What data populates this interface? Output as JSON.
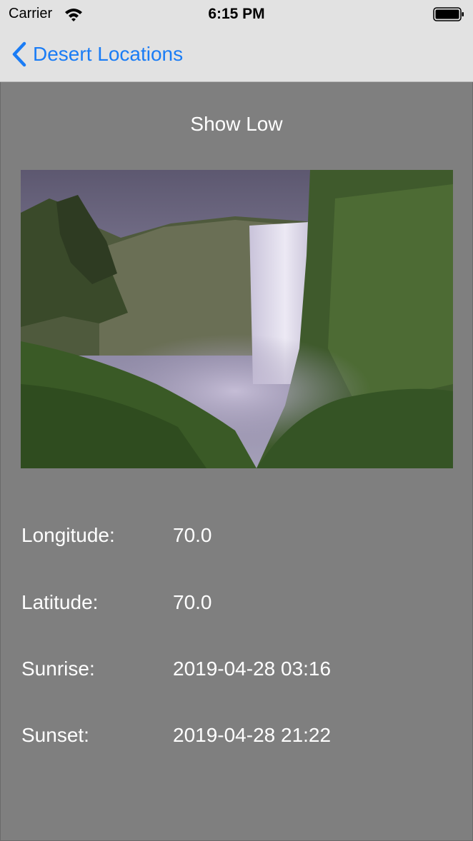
{
  "status_bar": {
    "carrier": "Carrier",
    "time": "6:15 PM"
  },
  "nav": {
    "back_label": "Desert Locations"
  },
  "main": {
    "toggle_label": "Show Low",
    "details": [
      {
        "label": "Longitude:",
        "value": "70.0"
      },
      {
        "label": "Latitude:",
        "value": "70.0"
      },
      {
        "label": "Sunrise:",
        "value": "2019-04-28 03:16"
      },
      {
        "label": "Sunset:",
        "value": "2019-04-28 21:22"
      }
    ]
  },
  "colors": {
    "accent": "#1a7cf5",
    "nav_background": "#e2e2e2",
    "page_background": "#7f7f7f",
    "text": "#ffffff"
  },
  "icons": {
    "status": [
      "wifi-icon",
      "battery-icon"
    ],
    "nav": [
      "chevron-left-icon"
    ]
  }
}
